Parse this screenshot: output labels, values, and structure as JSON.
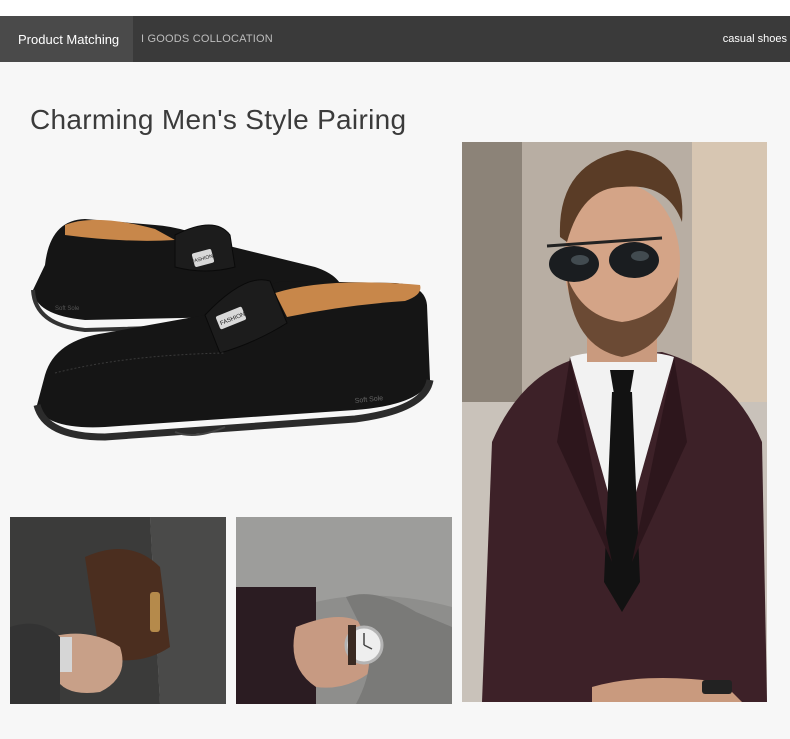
{
  "header": {
    "product_matching": "Product Matching",
    "goods_collocation": "I GOODS COLLOCATION",
    "casual_shoes": "casual shoes"
  },
  "main": {
    "title": "Charming Men's Style Pairing"
  },
  "shoe": {
    "badge_text": "FASHION",
    "sole_text": "Soft Sole"
  },
  "colors": {
    "header_bg": "#3a3a3a",
    "tab_bg": "#4a4a4a",
    "shoe_black": "#151515",
    "lining_tan": "#c8874a",
    "suit_burgundy": "#3d2128"
  }
}
